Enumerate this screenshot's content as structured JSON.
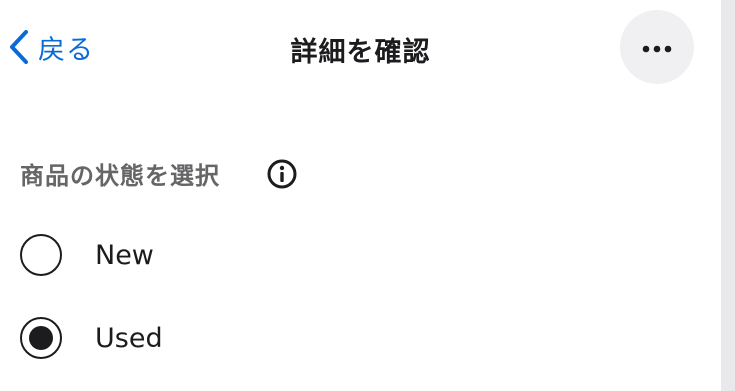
{
  "header": {
    "back_label": "戻る",
    "back_icon": "chevron-left-icon",
    "title": "詳細を確認",
    "more_icon": "ellipsis-icon"
  },
  "condition": {
    "label": "商品の状態を選択",
    "info_icon": "info-icon",
    "options": [
      {
        "label": "New",
        "selected": false
      },
      {
        "label": "Used",
        "selected": true
      }
    ]
  },
  "colors": {
    "accent": "#0a6bd6",
    "text": "#1c1c1e",
    "muted_text": "#666668",
    "more_button_bg": "#f0f0f2"
  }
}
